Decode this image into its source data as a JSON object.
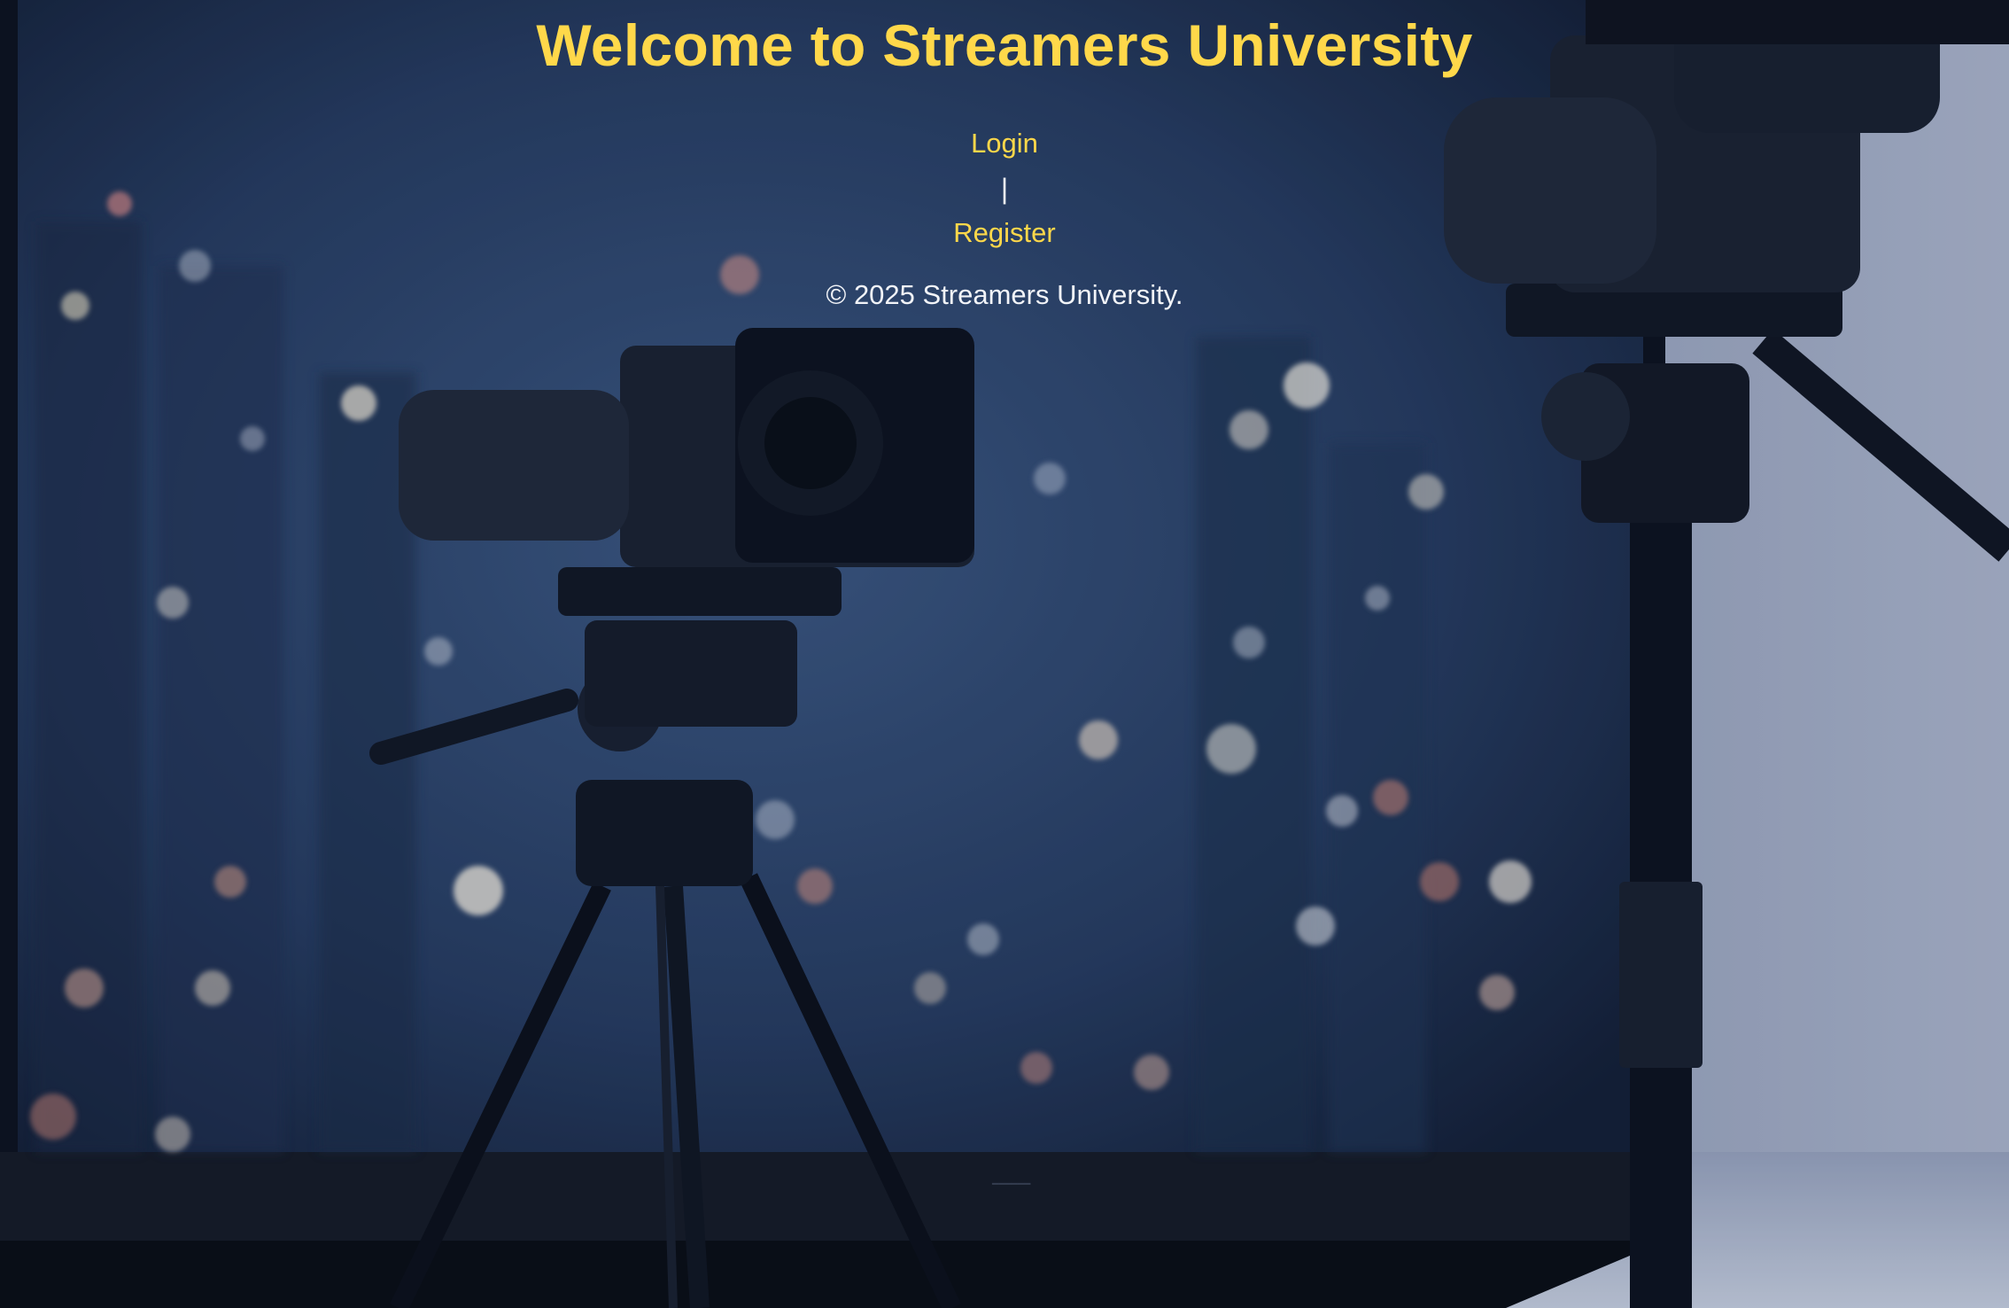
{
  "header": {
    "title": "Welcome to Streamers University"
  },
  "nav": {
    "login_label": "Login",
    "separator": "|",
    "register_label": "Register"
  },
  "footer": {
    "copyright": "© 2025 Streamers University."
  },
  "colors": {
    "title": "#ffd84a",
    "link": "#ffd84a",
    "footer_text": "#f2f4f8",
    "background": "#1e2f4f"
  },
  "background": {
    "icon": "camera-tripod-city-bokeh-image"
  }
}
